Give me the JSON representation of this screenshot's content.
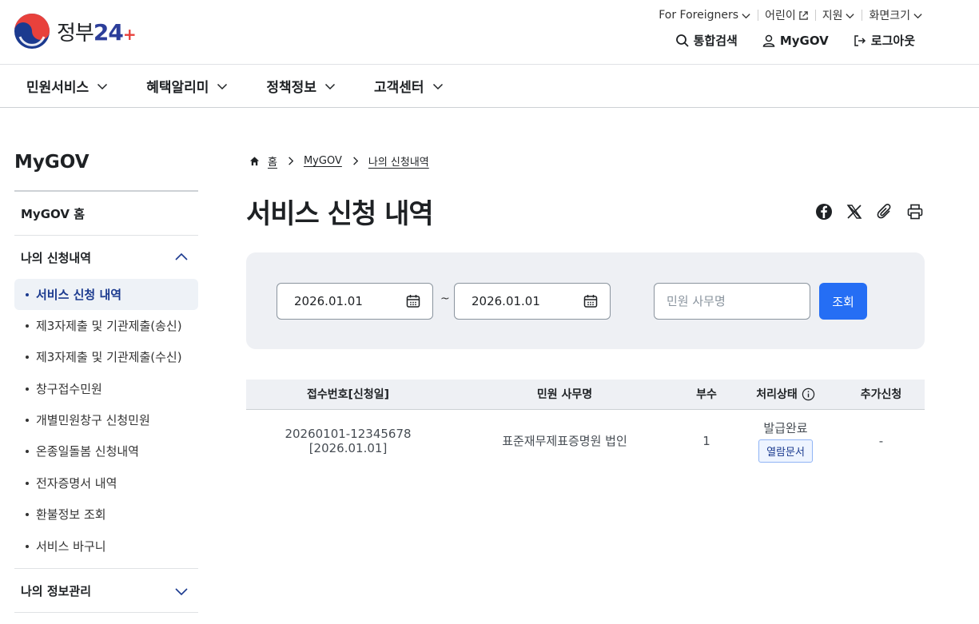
{
  "header": {
    "logo_text": "정부",
    "logo_number": "24",
    "logo_plus": "+",
    "util": [
      {
        "label": "For Foreigners",
        "icon": "chevron-down-icon"
      },
      {
        "label": "어린이",
        "icon": "external-link-icon"
      },
      {
        "label": "지원",
        "icon": "chevron-down-icon"
      },
      {
        "label": "화면크기",
        "icon": "chevron-down-icon"
      }
    ],
    "quick": [
      {
        "label": "통합검색",
        "icon": "search-icon"
      },
      {
        "label": "MyGOV",
        "icon": "user-icon"
      },
      {
        "label": "로그아웃",
        "icon": "logout-icon"
      }
    ]
  },
  "gnb": [
    {
      "label": "민원서비스"
    },
    {
      "label": "혜택알리미"
    },
    {
      "label": "정책정보"
    },
    {
      "label": "고객센터"
    }
  ],
  "sidebar": {
    "title": "MyGOV",
    "home": "MyGOV 홈",
    "section1": "나의 신청내역",
    "sub_items": [
      {
        "label": "서비스 신청 내역",
        "active": true
      },
      {
        "label": "제3자제출 및 기관제출(송신)"
      },
      {
        "label": "제3자제출 및 기관제출(수신)"
      },
      {
        "label": "창구접수민원"
      },
      {
        "label": "개별민원창구 신청민원"
      },
      {
        "label": "온종일돌봄 신청내역"
      },
      {
        "label": "전자증명서 내역"
      },
      {
        "label": "환불정보 조회"
      },
      {
        "label": "서비스 바구니"
      }
    ],
    "section2": "나의 정보관리"
  },
  "breadcrumb": [
    "홈",
    "MyGOV",
    "나의 신청내역"
  ],
  "page_title": "서비스 신청 내역",
  "search": {
    "start_date": "2026.01.01",
    "end_date": "2026.01.01",
    "separator": "~",
    "placeholder": "민원 사무명",
    "button": "조회"
  },
  "table": {
    "headers": [
      "접수번호[신청일]",
      "민원 사무명",
      "부수",
      "처리상태",
      "추가신청"
    ],
    "rows": [
      {
        "receipt_no": "20260101-12345678",
        "date": "[2026.01.01]",
        "name": "표준재무제표증명원 법인",
        "count": "1",
        "status": "발급완료",
        "doc_button": "열람문서",
        "extra": "-"
      }
    ]
  },
  "colors": {
    "primary": "#256ef4",
    "navy": "#1b3a8f",
    "panel_bg": "#eef0f4"
  }
}
